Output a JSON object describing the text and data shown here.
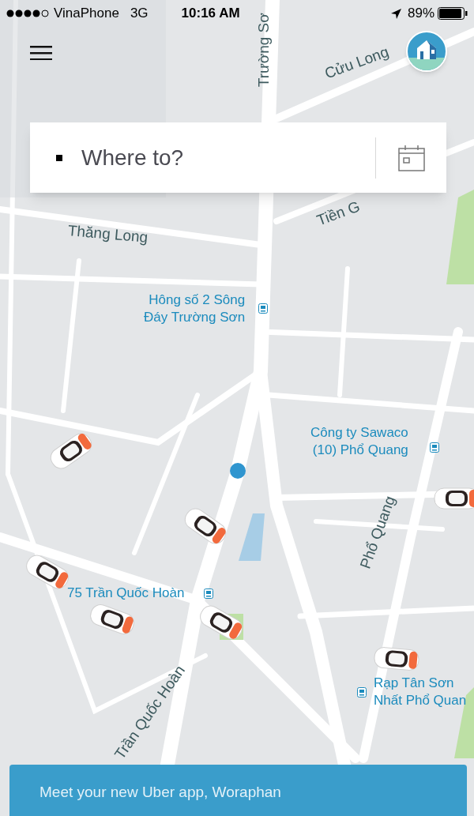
{
  "status_bar": {
    "carrier": "VinaPhone",
    "network": "3G",
    "time": "10:16 AM",
    "battery": "89%"
  },
  "search": {
    "placeholder": "Where to?"
  },
  "map": {
    "streets": [
      {
        "name": "Trường Sơ"
      },
      {
        "name": "Cửu Long"
      },
      {
        "name": "Tiền G"
      },
      {
        "name": "Thăng Long"
      },
      {
        "name": "Phổ Quang"
      },
      {
        "name": "Trần Quốc Hoàn"
      }
    ],
    "places": [
      {
        "name": "Hông số 2 Sông\nĐáy Trường Sơn"
      },
      {
        "name": "Công ty Sawaco\n(10) Phổ Quang"
      },
      {
        "name": "75 Trần Quốc Hoàn"
      },
      {
        "name": "Rạp Tân Sơn\nNhất Phổ Quan"
      }
    ]
  },
  "banner": {
    "text": "Meet your new Uber app, Woraphan"
  }
}
